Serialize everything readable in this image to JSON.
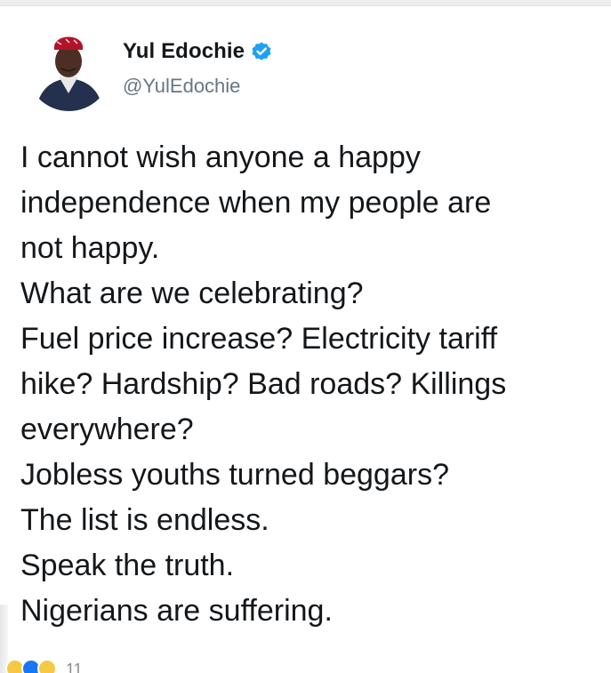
{
  "author": {
    "display_name": "Yul Edochie",
    "handle": "@YulEdochie",
    "verified": true,
    "verified_color": "#1da1f2"
  },
  "tweet": {
    "lines": [
      "I cannot wish anyone a happy",
      "independence when my people are",
      "not happy.",
      "What are we celebrating?",
      "Fuel price increase? Electricity tariff",
      "hike? Hardship? Bad roads? Killings",
      "everywhere?",
      "Jobless youths turned beggars?",
      "The list is endless.",
      "Speak the truth.",
      "Nigerians are suffering."
    ]
  },
  "reactions": {
    "icons": [
      "sad-reaction-icon",
      "like-reaction-icon",
      "haha-reaction-icon"
    ],
    "count": "11"
  }
}
